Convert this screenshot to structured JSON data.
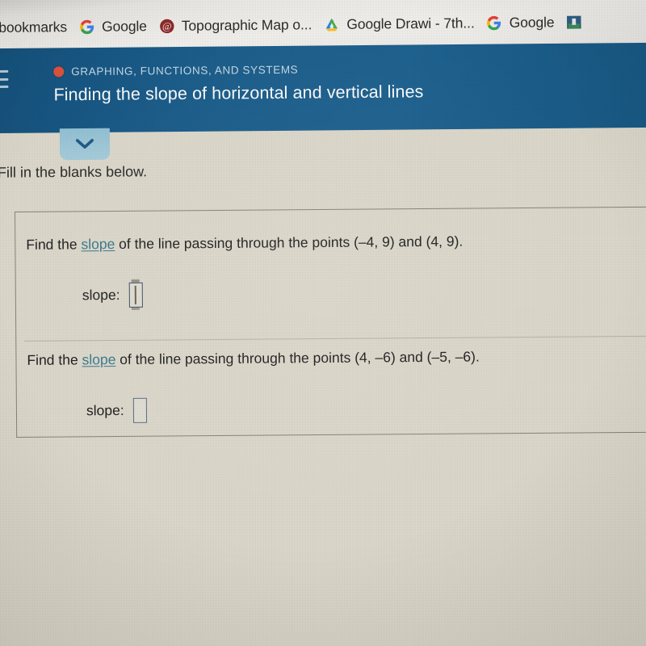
{
  "browser": {
    "bookmarks_bar": {
      "items": [
        {
          "label": "bookmarks",
          "icon": "folder-icon",
          "truncated_left": true
        },
        {
          "label": "Google",
          "icon": "google-g-icon"
        },
        {
          "label": "Topographic Map o...",
          "icon": "at-sign-icon"
        },
        {
          "label": "Google Drawi - 7th...",
          "icon": "google-drive-icon"
        },
        {
          "label": "Google",
          "icon": "google-g-icon"
        },
        {
          "label": "",
          "icon": "site-favicon-icon"
        }
      ]
    }
  },
  "app_header": {
    "menu_icon": "hamburger-menu-icon",
    "eyebrow_dot_color": "#e2533c",
    "eyebrow": "GRAPHING, FUNCTIONS, AND SYSTEMS",
    "title": "Finding the slope of horizontal and vertical lines",
    "background_color": "#1a5d8c"
  },
  "collapse_tab": {
    "icon": "chevron-down-icon",
    "background_color": "#a2cbdb",
    "chevron_color": "#1d5e86"
  },
  "instruction": "Fill in the blanks below.",
  "exercise": {
    "questions": [
      {
        "prompt_prefix": "Find the ",
        "link_text": "slope",
        "prompt_suffix": " of the line passing through the points (–4, 9) and (4, 9).",
        "answer_label": "slope:",
        "answer_value": "",
        "focused": true
      },
      {
        "prompt_prefix": "Find the ",
        "link_text": "slope",
        "prompt_suffix": " of the line passing through the points (4, –6) and (–5, –6).",
        "answer_label": "slope:",
        "answer_value": "",
        "focused": false
      }
    ],
    "link_color": "#3c7c91",
    "border_color": "#8a857b"
  },
  "page_background_color": "#dedacd"
}
